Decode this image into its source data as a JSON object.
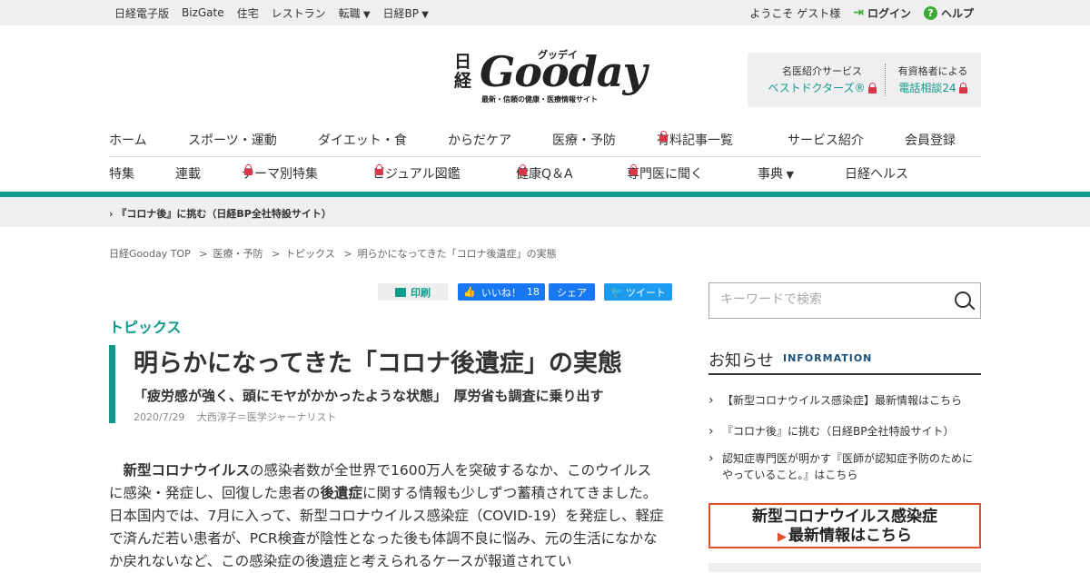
{
  "topbar": {
    "links": [
      "日経電子版",
      "BizGate",
      "住宅",
      "レストラン",
      "転職",
      "日経BP"
    ],
    "welcome": "ようこそ ゲスト様",
    "login": "ログイン",
    "help": "ヘルプ"
  },
  "logo": {
    "nikkei": "日経",
    "gooday": "Gooday",
    "kana": "グッデイ",
    "tagline": "最新・信頼の健康・医療情報サイト"
  },
  "services": {
    "s1_label": "名医紹介サービス",
    "s1_link": "ベストドクターズ®",
    "s2_label": "有資格者による",
    "s2_link": "電話相談24"
  },
  "nav": {
    "row1": [
      "ホーム",
      "スポーツ・運動",
      "ダイエット・食",
      "からだケア",
      "医療・予防",
      "有料記事一覧",
      "サービス紹介",
      "会員登録"
    ],
    "row2": [
      "特集",
      "連載",
      "テーマ別特集",
      "ビジュアル図鑑",
      "健康Q＆A",
      "専門医に聞く",
      "事典",
      "日経ヘルス"
    ]
  },
  "subbar": "『コロナ後』に挑む（日経BP全社特設サイト）",
  "breadcrumb": [
    "日経Gooday TOP",
    "医療・予防",
    "トピックス",
    "明らかになってきた「コロナ後遺症」の実態"
  ],
  "share": {
    "print": "印刷",
    "like": "いいね！",
    "like_count": "18",
    "share": "シェア",
    "tweet": "ツイート"
  },
  "article": {
    "category": "トピックス",
    "title": "明らかになってきた「コロナ後遺症」の実態",
    "subtitle": "「疲労感が強く、頭にモヤがかかったような状態」　厚労省も調査に乗り出す",
    "date": "2020/7/29",
    "author": "大西淳子＝医学ジャーナリスト",
    "p_lead_bold": "新型コロナウイルス",
    "p_part1": "の感染者数が全世界で1600万人を突破するなか、このウイルスに感染・発症し、回復した患者の",
    "p_bold2": "後遺症",
    "p_part2": "に関する情報も少しずつ蓄積されてきました。日本国内では、7月に入って、新型コロナウイルス感染症（COVID-19）を発症し、軽症で済んだ若い患者が、PCR検査が陰性となった後も体調不良に悩み、元の生活になかなか戻れないなど、この感染症の後遺症と考えられるケースが報道されてい"
  },
  "sidebar": {
    "search_placeholder": "キーワードで検索",
    "news_title": "お知らせ",
    "news_en": "INFORMATION",
    "news": [
      "【新型コロナウイルス感染症】最新情報はこちら",
      "『コロナ後』に挑む（日経BP全社特設サイト）",
      "認知症専門医が明かす『医師が認知症予防のためにやっていること。』はこちら"
    ],
    "banner_l1": "新型コロナウイルス感染症",
    "banner_l2": "最新情報はこちら"
  }
}
